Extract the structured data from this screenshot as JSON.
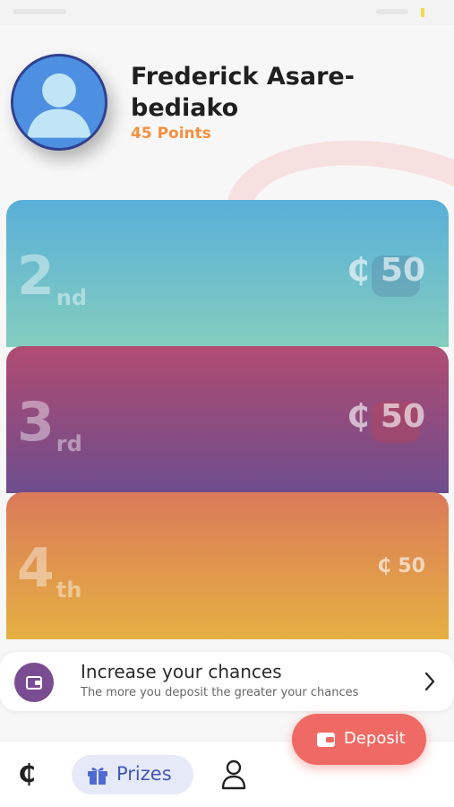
{
  "user": {
    "name": "Frederick Asare-bediako",
    "points": "45 Points"
  },
  "prizes": [
    {
      "rank_number": "2",
      "rank_suffix": "nd",
      "amount": "₵ 50"
    },
    {
      "rank_number": "3",
      "rank_suffix": "rd",
      "amount": "₵ 50"
    },
    {
      "rank_number": "4",
      "rank_suffix": "th",
      "amount": "₵ 50"
    }
  ],
  "chance_banner": {
    "title": "Increase your chances",
    "subtitle": "The more you deposit the greater your chances"
  },
  "nav": {
    "cedi_symbol": "₵",
    "prizes_label": "Prizes",
    "active_tab": "Prizes"
  },
  "deposit_label": "Deposit",
  "colors": {
    "points": "#f3903f",
    "deposit": "#ef6a64",
    "nav_active_text": "#4257b8",
    "card_2_top": "#58afd8",
    "card_3_top": "#b14c72",
    "card_4_top": "#db7a5a"
  },
  "icons": [
    "avatar-icon",
    "wallet-icon",
    "chevron-right-icon",
    "gift-icon",
    "profile-icon"
  ]
}
